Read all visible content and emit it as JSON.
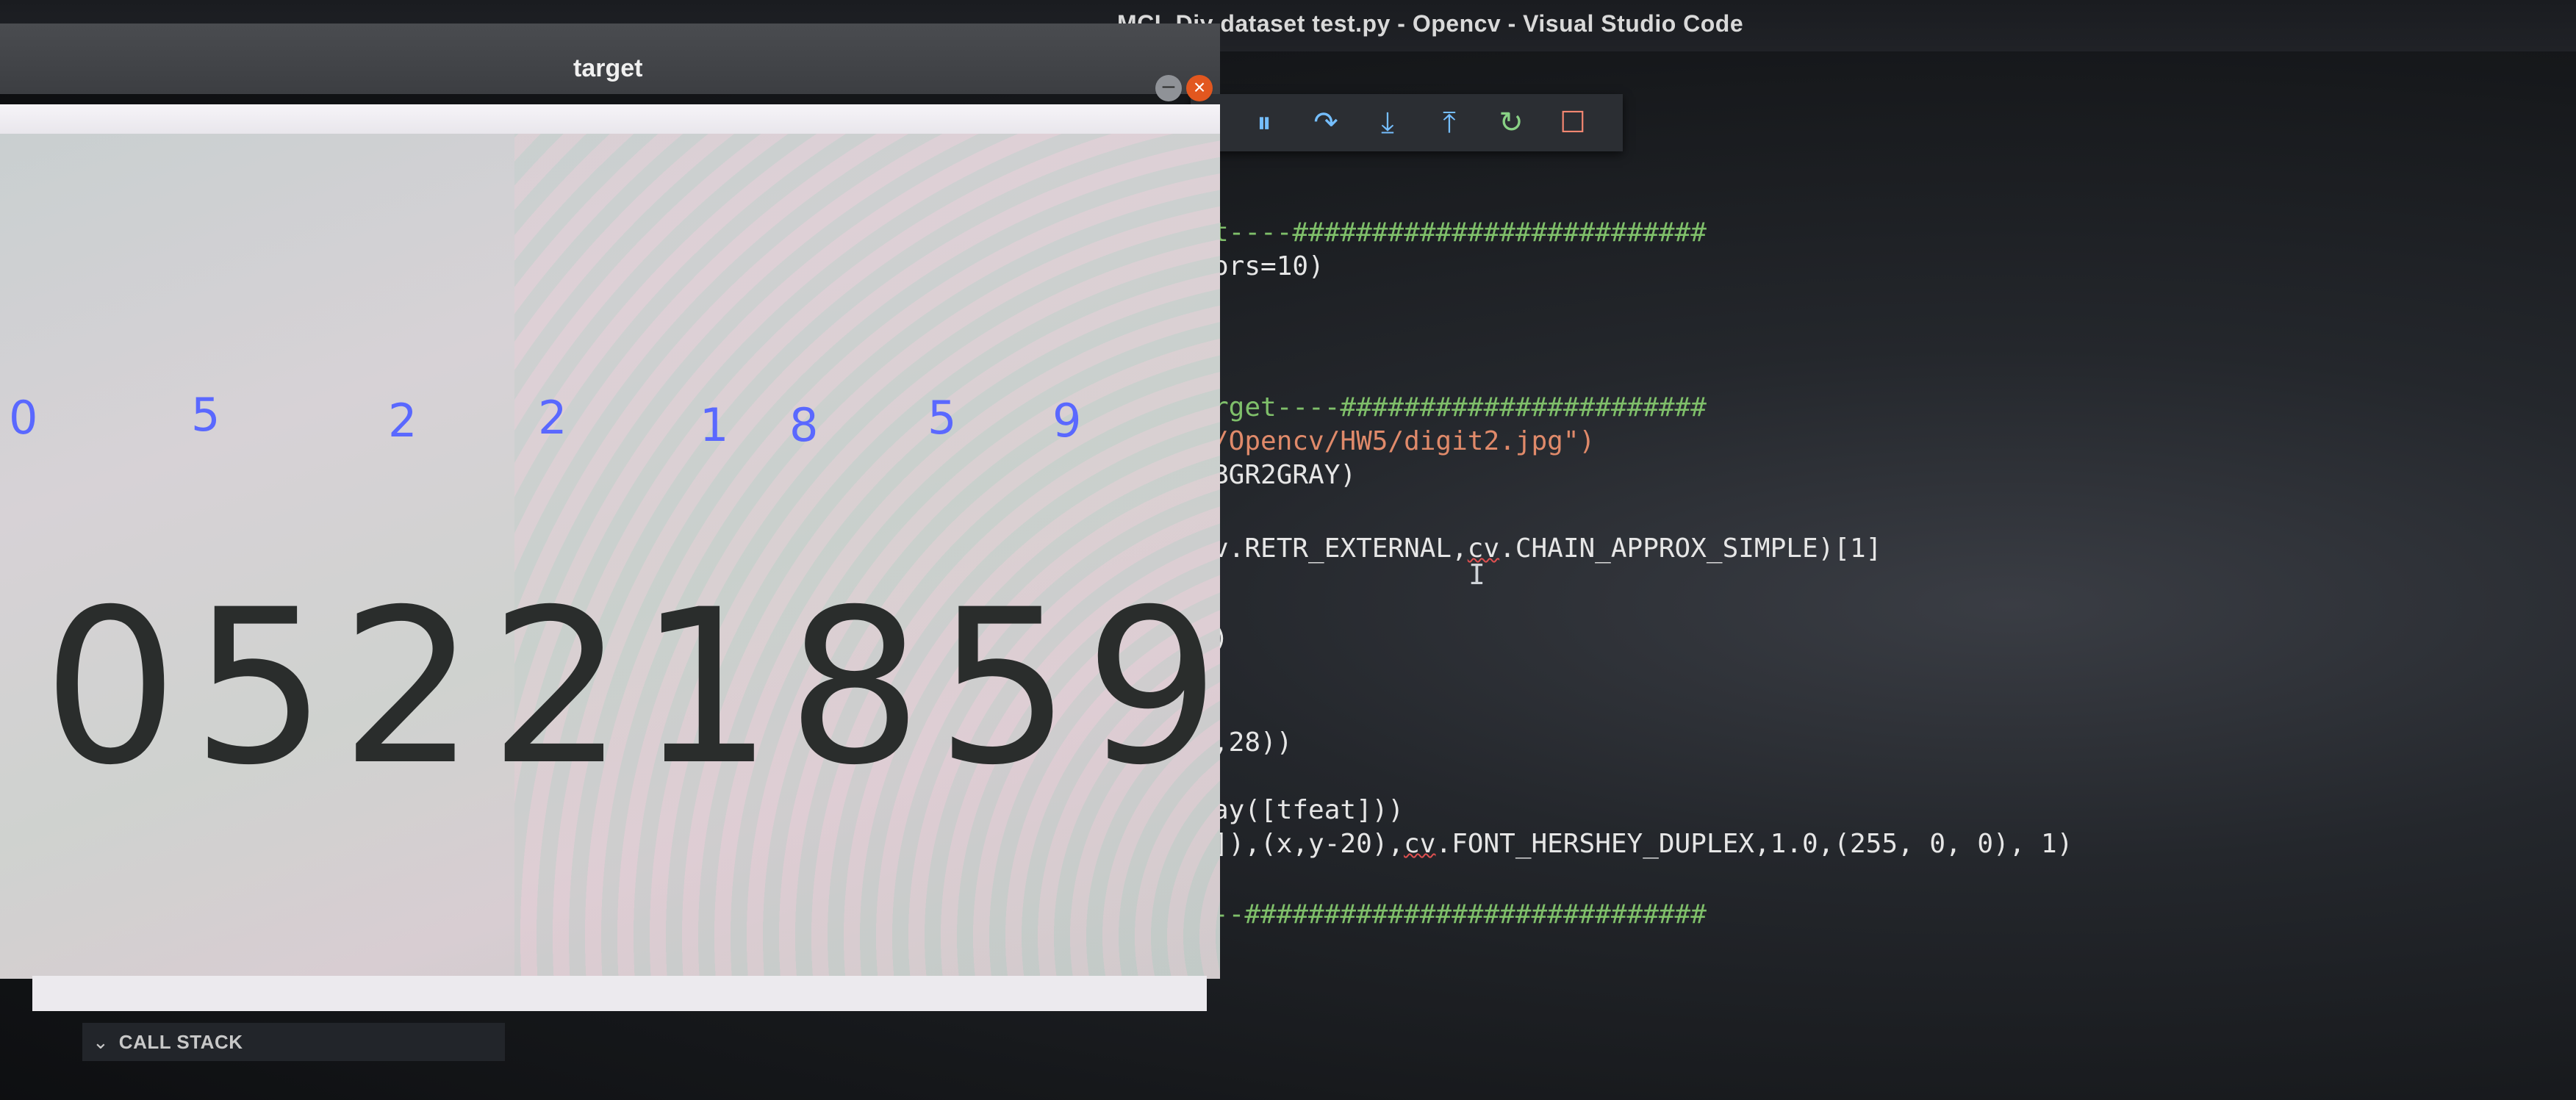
{
  "vscode": {
    "window_title": "MCL Diy dataset test.py - Opencv - Visual Studio Code",
    "debug_toolbar": [
      {
        "icon": "drag-grip-icon",
        "glyph": "⠿",
        "color": "#9aa0a6"
      },
      {
        "icon": "pause-icon",
        "glyph": "⏸",
        "color": "#75beff"
      },
      {
        "icon": "step-over-icon",
        "glyph": "↷",
        "color": "#75beff"
      },
      {
        "icon": "step-into-icon",
        "glyph": "⤓",
        "color": "#75beff"
      },
      {
        "icon": "step-out-icon",
        "glyph": "⤒",
        "color": "#75beff"
      },
      {
        "icon": "restart-icon",
        "glyph": "↻",
        "color": "#89d185"
      },
      {
        "icon": "stop-icon",
        "glyph": "☐",
        "color": "#f48771"
      }
    ],
    "code": {
      "line1_comment": "t----##########################",
      "line2": "ors=10)",
      "line3_comment": "rget----#######################",
      "line4_string": "/Opencv/HW5/digit2.jpg\")",
      "line5": "BGR2GRAY)",
      "line6_pre": "v.RETR_EXTERNAL,",
      "line6_squig": "cv",
      "line6_post": ".CHAIN_APPROX_SIMPLE)[1]",
      "line7": ")",
      "line8": ",28))",
      "line9": "ay([tfeat]))",
      "line10_pre": "]),(x,y-20),",
      "line10_squig": "cv",
      "line10_post": ".FONT_HERSHEY_DUPLEX,1.0,(255, 0, 0), 1)",
      "line11_comment": "--#############################"
    },
    "ibeam": "I",
    "callstack_label": "CALL STACK"
  },
  "target_window": {
    "title": "target",
    "minimize_glyph": "–",
    "close_glyph": "×",
    "predicted_labels": [
      "0",
      "5",
      "2",
      "2",
      "1",
      "8",
      "5",
      "9"
    ],
    "handwritten_digits": "05221859",
    "label_color": "#5a68ff"
  }
}
